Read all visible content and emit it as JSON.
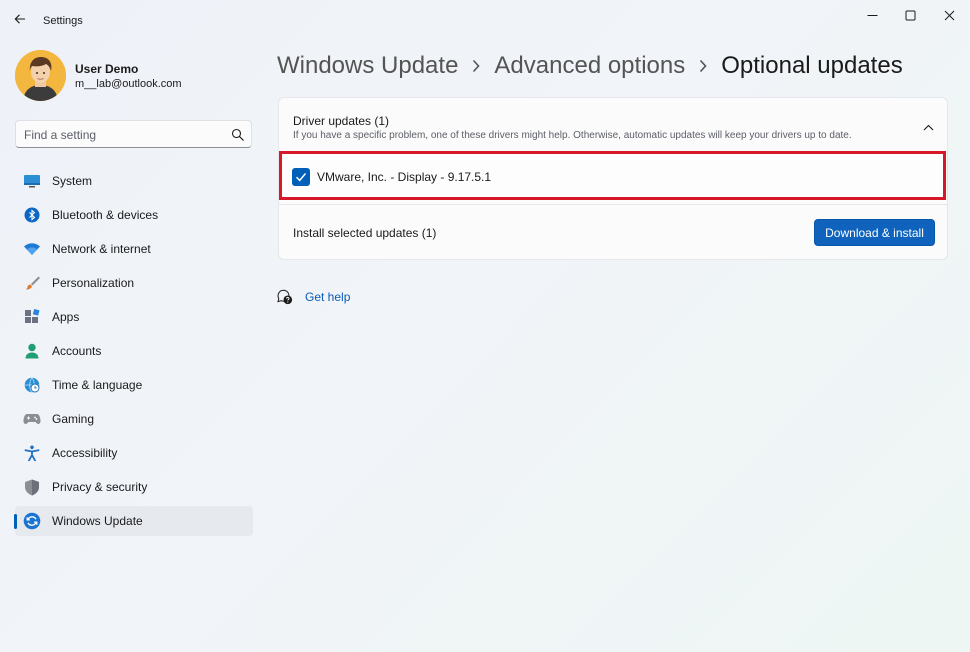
{
  "window": {
    "title": "Settings"
  },
  "user": {
    "name": "User Demo",
    "email": "m__lab@outlook.com"
  },
  "search": {
    "placeholder": "Find a setting"
  },
  "sidebar": {
    "items": [
      {
        "label": "System",
        "icon": "monitor-icon"
      },
      {
        "label": "Bluetooth & devices",
        "icon": "bluetooth-icon"
      },
      {
        "label": "Network & internet",
        "icon": "wifi-icon"
      },
      {
        "label": "Personalization",
        "icon": "brush-icon"
      },
      {
        "label": "Apps",
        "icon": "apps-icon"
      },
      {
        "label": "Accounts",
        "icon": "person-icon"
      },
      {
        "label": "Time & language",
        "icon": "globe-clock-icon"
      },
      {
        "label": "Gaming",
        "icon": "gamepad-icon"
      },
      {
        "label": "Accessibility",
        "icon": "accessibility-icon"
      },
      {
        "label": "Privacy & security",
        "icon": "shield-icon"
      },
      {
        "label": "Windows Update",
        "icon": "refresh-icon",
        "active": true
      }
    ]
  },
  "breadcrumb": {
    "items": [
      "Windows Update",
      "Advanced options",
      "Optional updates"
    ]
  },
  "driver_updates": {
    "title": "Driver updates (1)",
    "description": "If you have a specific problem, one of these drivers might help. Otherwise, automatic updates will keep your drivers up to date.",
    "items": [
      {
        "label": "VMware, Inc. - Display - 9.17.5.1",
        "checked": true
      }
    ],
    "install_label": "Install selected updates (1)",
    "install_button": "Download & install"
  },
  "help": {
    "label": "Get help"
  },
  "colors": {
    "accent": "#005fb8",
    "highlight": "#d7182a"
  }
}
